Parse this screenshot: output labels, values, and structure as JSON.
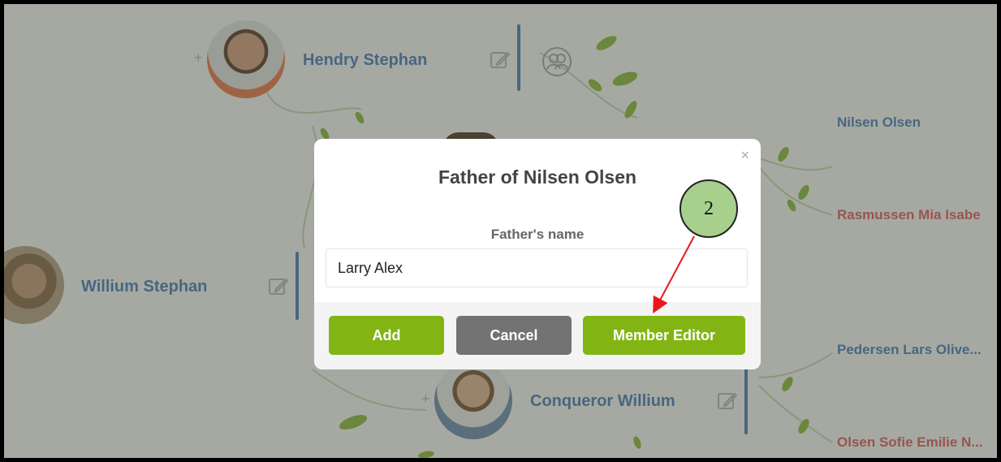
{
  "tree": {
    "members": {
      "top": "Hendry Stephan",
      "left": "Willium Stephan",
      "bottom": "Conqueror Willium"
    },
    "right_list": [
      {
        "name": "Nilsen Olsen",
        "color": "#4a7fc0"
      },
      {
        "name": "Rasmussen Mia Isabe",
        "color": "#e06060"
      },
      {
        "name": "Pedersen Lars Olive...",
        "color": "#4a7fc0"
      },
      {
        "name": "Olsen Sofie Emilie N...",
        "color": "#e06060"
      }
    ],
    "plus_symbol": "+"
  },
  "dialog": {
    "title": "Father of Nilsen Olsen",
    "close_symbol": "×",
    "field_label": "Father's name",
    "field_value": "Larry Alex",
    "buttons": {
      "add": "Add",
      "cancel": "Cancel",
      "member_editor": "Member Editor"
    }
  },
  "annotation": {
    "step_number": "2"
  },
  "colors": {
    "green_button": "#82b514",
    "gray_button": "#737373",
    "badge_fill": "#a8d08d",
    "arrow": "#e8191c",
    "name_blue": "#4a7fc0",
    "name_red": "#e06060"
  }
}
